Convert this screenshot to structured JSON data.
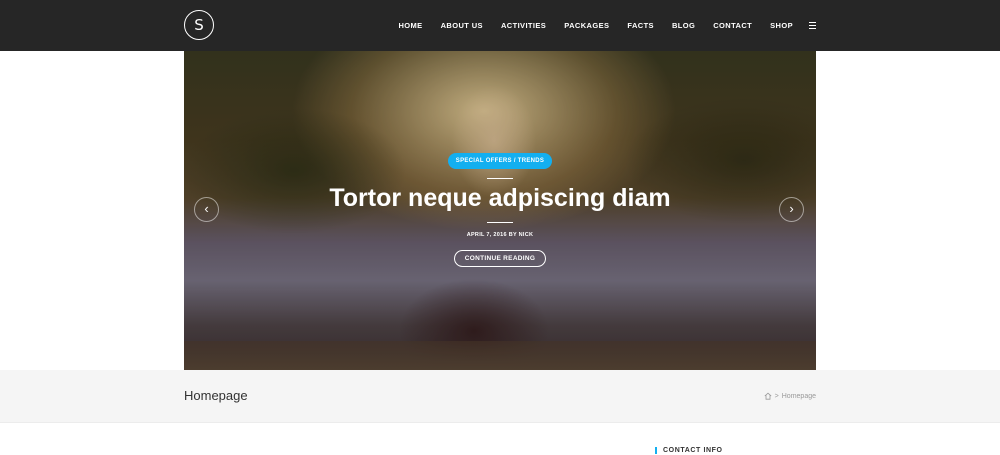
{
  "header": {
    "logo_letter": "S",
    "nav": [
      "HOME",
      "ABOUT US",
      "ACTIVITIES",
      "PACKAGES",
      "FACTS",
      "BLOG",
      "CONTACT",
      "SHOP"
    ]
  },
  "hero": {
    "category": "SPECIAL OFFERS / TRENDS",
    "title": "Tortor neque adpiscing diam",
    "meta": "APRIL 7, 2016 BY NICK",
    "button": "CONTINUE READING"
  },
  "page": {
    "title": "Homepage",
    "breadcrumb_current": "Homepage"
  },
  "sidebar": {
    "contact_heading": "CONTACT INFO"
  },
  "colors": {
    "accent": "#13aff0",
    "topbar": "#262626"
  }
}
